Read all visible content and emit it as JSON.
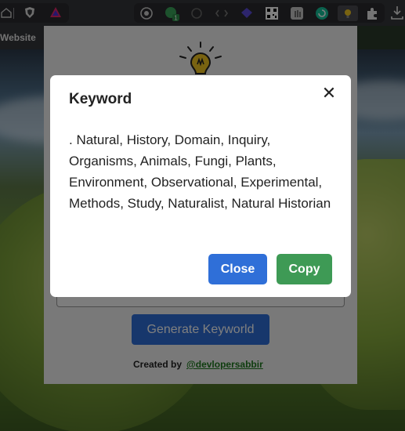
{
  "bookmark_bar": {
    "visible_item": "Website"
  },
  "popup": {
    "generate_button": "Generate Keyworld",
    "credit_label": "Created by",
    "credit_link": "@devlopersabbir"
  },
  "dialog": {
    "title": "Keyword",
    "body": ". Natural, History, Domain, Inquiry, Organisms, Animals, Fungi, Plants, Environment, Observational, Experimental, Methods, Study, Naturalist, Natural Historian",
    "close_button": "Close",
    "copy_button": "Copy"
  },
  "colors": {
    "primary": "#2f6fd8",
    "success": "#3e9a55",
    "link": "#1f7a1f"
  }
}
